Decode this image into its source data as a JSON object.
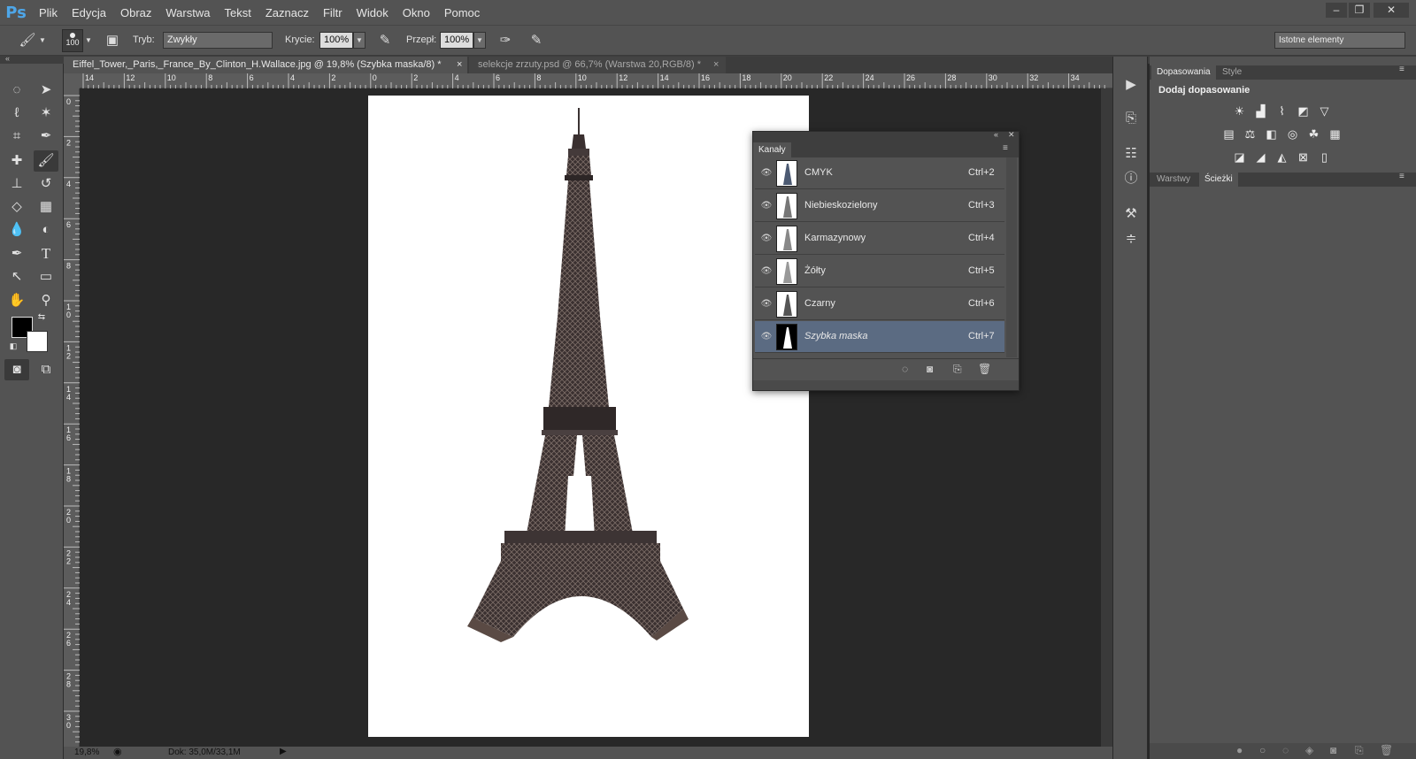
{
  "app": {
    "logo": "Ps"
  },
  "menu": [
    "Plik",
    "Edycja",
    "Obraz",
    "Warstwa",
    "Tekst",
    "Zaznacz",
    "Filtr",
    "Widok",
    "Okno",
    "Pomoc"
  ],
  "window_controls": {
    "minimize": "‒",
    "restore": "❐",
    "close": "✕"
  },
  "options": {
    "brush_size": "100",
    "mode_label": "Tryb:",
    "mode_value": "Zwykły",
    "opacity_label": "Krycie:",
    "opacity_value": "100%",
    "flow_label": "Przepł:",
    "flow_value": "100%",
    "workspace": "Istotne elementy"
  },
  "tabs": [
    {
      "title": "Eiffel_Tower,_Paris,_France_By_Clinton_H.Wallace.jpg @ 19,8% (Szybka maska/8) *",
      "close": "×",
      "active": true
    },
    {
      "title": "selekcje zrzuty.psd @ 66,7% (Warstwa 20,RGB/8) *",
      "close": "×",
      "active": false
    }
  ],
  "ruler_top": [
    "14",
    "12",
    "10",
    "8",
    "6",
    "4",
    "2",
    "0",
    "2",
    "4",
    "6",
    "8",
    "10",
    "12",
    "14",
    "16",
    "18",
    "20",
    "22",
    "24",
    "26",
    "28",
    "30",
    "32",
    "34"
  ],
  "ruler_left": [
    "0",
    "2",
    "4",
    "6",
    "8",
    "10",
    "12",
    "14",
    "16",
    "18",
    "20",
    "22",
    "24",
    "26",
    "28",
    "30"
  ],
  "status": {
    "zoom": "19,8%",
    "doc": "Dok: 35,0M/33,1M"
  },
  "channels_panel": {
    "title": "Kanały",
    "channels": [
      {
        "name": "CMYK",
        "shortcut": "Ctrl+2",
        "selected": false
      },
      {
        "name": "Niebieskozielony",
        "shortcut": "Ctrl+3",
        "selected": false
      },
      {
        "name": "Karmazynowy",
        "shortcut": "Ctrl+4",
        "selected": false
      },
      {
        "name": "Żółty",
        "shortcut": "Ctrl+5",
        "selected": false
      },
      {
        "name": "Czarny",
        "shortcut": "Ctrl+6",
        "selected": false
      },
      {
        "name": "Szybka maska",
        "shortcut": "Ctrl+7",
        "selected": true
      }
    ]
  },
  "right_panel": {
    "top_tabs": [
      "Dopasowania",
      "Style"
    ],
    "add_adjustment": "Dodaj dopasowanie",
    "bottom_tabs": [
      "Warstwy",
      "Ścieżki"
    ]
  },
  "colors": {
    "accent_selected": "#5b6b82",
    "ps_blue": "#4ea6e8"
  }
}
